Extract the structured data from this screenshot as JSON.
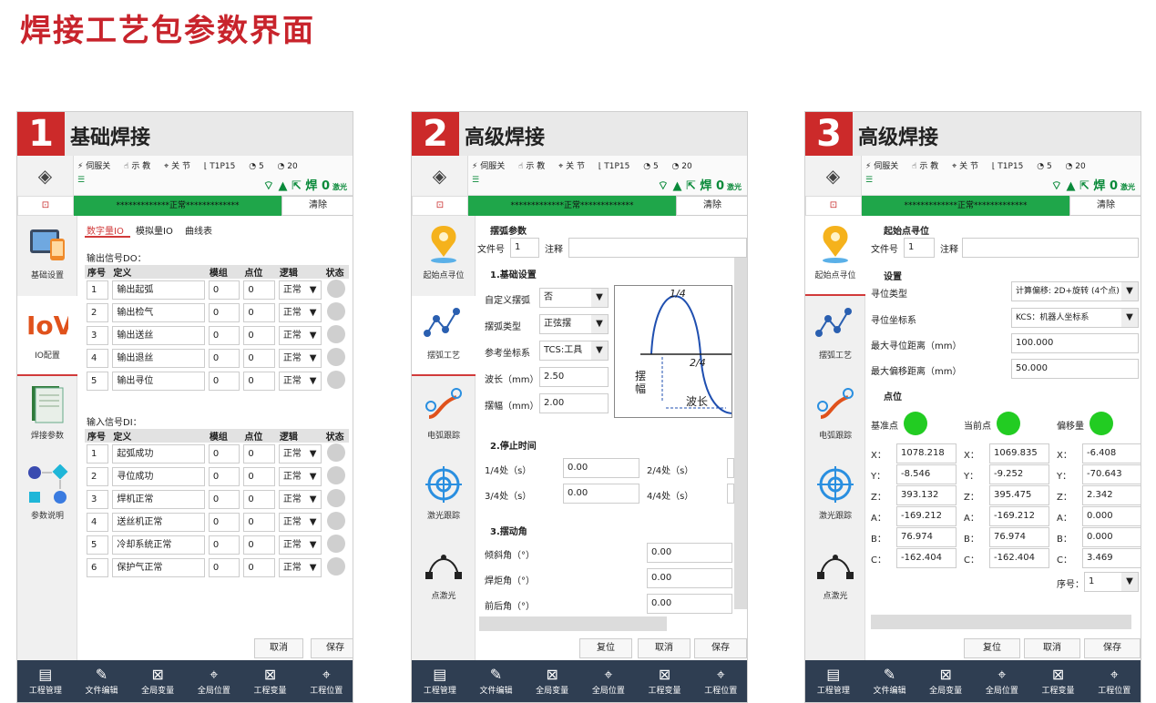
{
  "page_title": "焊接工艺包参数界面",
  "status": {
    "servo": "伺服关",
    "teach": "示 教",
    "joint": "关 节",
    "tool": "T1P15",
    "speed1": "5",
    "speed2": "20",
    "weld": "焊",
    "weld_count": "0",
    "laser": "激光",
    "alarm_text": "*************正常*************",
    "clear": "清除"
  },
  "nav_bottom": [
    "工程管理",
    "文件编辑",
    "全局变量",
    "全局位置",
    "工程变量",
    "工程位置"
  ],
  "panel1": {
    "num": "1",
    "title": "基础焊接",
    "side": [
      "基础设置",
      "IO配置",
      "焊接参数",
      "参数说明"
    ],
    "tabs": [
      "数字量IO",
      "模拟量IO",
      "曲线表"
    ],
    "do_title": "输出信号DO：",
    "headers": [
      "序号",
      "定义",
      "模组",
      "点位",
      "逻辑",
      "状态"
    ],
    "do_rows": [
      {
        "no": "1",
        "def": "输出起弧",
        "mod": "0",
        "pt": "0",
        "logic": "正常"
      },
      {
        "no": "2",
        "def": "输出检气",
        "mod": "0",
        "pt": "0",
        "logic": "正常"
      },
      {
        "no": "3",
        "def": "输出送丝",
        "mod": "0",
        "pt": "0",
        "logic": "正常"
      },
      {
        "no": "4",
        "def": "输出退丝",
        "mod": "0",
        "pt": "0",
        "logic": "正常"
      },
      {
        "no": "5",
        "def": "输出寻位",
        "mod": "0",
        "pt": "0",
        "logic": "正常"
      }
    ],
    "di_title": "输入信号DI：",
    "di_rows": [
      {
        "no": "1",
        "def": "起弧成功",
        "mod": "0",
        "pt": "0",
        "logic": "正常"
      },
      {
        "no": "2",
        "def": "寻位成功",
        "mod": "0",
        "pt": "0",
        "logic": "正常"
      },
      {
        "no": "3",
        "def": "焊机正常",
        "mod": "0",
        "pt": "0",
        "logic": "正常"
      },
      {
        "no": "4",
        "def": "送丝机正常",
        "mod": "0",
        "pt": "0",
        "logic": "正常"
      },
      {
        "no": "5",
        "def": "冷却系统正常",
        "mod": "0",
        "pt": "0",
        "logic": "正常"
      },
      {
        "no": "6",
        "def": "保护气正常",
        "mod": "0",
        "pt": "0",
        "logic": "正常"
      }
    ],
    "cancel": "取消",
    "save": "保存"
  },
  "side_adv": [
    "起始点寻位",
    "摆弧工艺",
    "电弧跟踪",
    "激光跟踪",
    "点激光"
  ],
  "panel2": {
    "num": "2",
    "title": "高级焊接",
    "section": "摆弧参数",
    "file_label": "文件号",
    "file_no": "1",
    "note_label": "注释",
    "basic": "1.基础设置",
    "custom_label": "自定义摆弧",
    "custom_val": "否",
    "type_label": "摆弧类型",
    "type_val": "正弦摆",
    "coord_label": "参考坐标系",
    "coord_val": "TCS:工具",
    "wave_label": "波长（mm）",
    "wave_val": "2.50",
    "amp_label": "摆幅（mm）",
    "amp_val": "2.00",
    "diag_q1": "1/4",
    "diag_q2": "2/4",
    "diag_amp": "摆幅",
    "diag_wave": "波长",
    "stop": "2.停止时间",
    "t14_label": "1/4处（s）",
    "t14_val": "0.00",
    "t24_label": "2/4处（s）",
    "t34_label": "3/4处（s）",
    "t34_val": "0.00",
    "t44_label": "4/4处（s）",
    "angle": "3.摆动角",
    "tilt_label": "倾斜角（°）",
    "tilt_val": "0.00",
    "torch_label": "焊炬角（°）",
    "torch_val": "0.00",
    "front_label": "前后角（°）",
    "front_val": "0.00",
    "reset": "复位",
    "cancel": "取消",
    "save": "保存"
  },
  "panel3": {
    "num": "3",
    "title": "高级焊接",
    "section": "起始点寻位",
    "file_label": "文件号",
    "file_no": "1",
    "note_label": "注释",
    "setting": "设置",
    "type_label": "寻位类型",
    "type_val": "计算偏移: 2D+旋转 (4个点)",
    "coord_label": "寻位坐标系",
    "coord_val": "KCS：机器人坐标系",
    "maxd_label": "最大寻位距离（mm）",
    "maxd_val": "100.000",
    "maxo_label": "最大偏移距离（mm）",
    "maxo_val": "50.000",
    "points": "点位",
    "base": "基准点",
    "current": "当前点",
    "offset": "偏移量",
    "axes": [
      "X：",
      "Y：",
      "Z：",
      "A：",
      "B：",
      "C："
    ],
    "base_vals": [
      "1078.218",
      "-8.546",
      "393.132",
      "-169.212",
      "76.974",
      "-162.404"
    ],
    "cur_vals": [
      "1069.835",
      "-9.252",
      "395.475",
      "-169.212",
      "76.974",
      "-162.404"
    ],
    "off_vals": [
      "-6.408",
      "-70.643",
      "2.342",
      "0.000",
      "0.000",
      "3.469"
    ],
    "seq_label": "序号：",
    "seq_val": "1",
    "reset": "复位",
    "cancel": "取消",
    "save": "保存"
  }
}
